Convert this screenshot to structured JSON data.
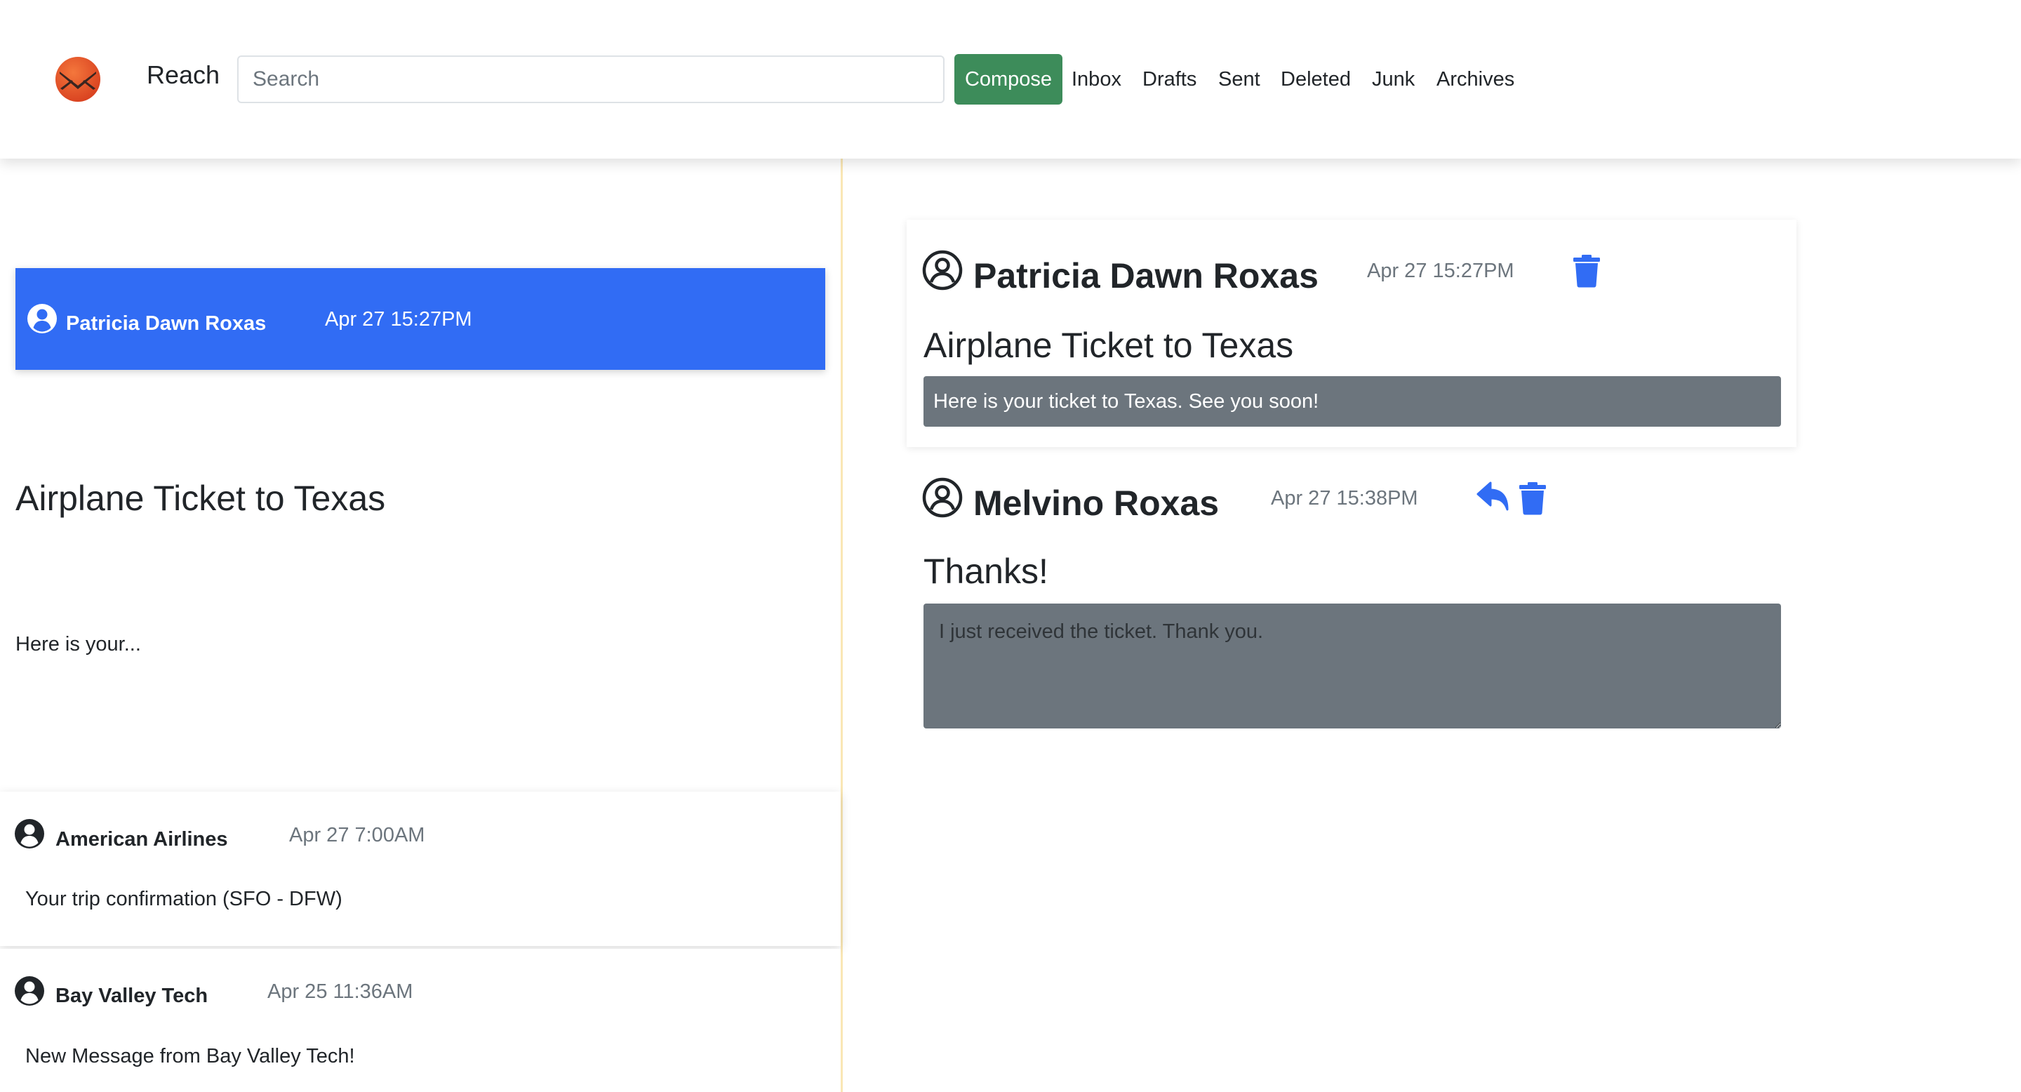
{
  "header": {
    "brand": "Reach",
    "search_placeholder": "Search",
    "compose_label": "Compose",
    "nav": [
      "Inbox",
      "Drafts",
      "Sent",
      "Deleted",
      "Junk",
      "Archives"
    ]
  },
  "colors": {
    "accent": "#316cf4",
    "compose": "#3d8c5a",
    "message_box": "#6c757d",
    "divider": "#fae7b5",
    "logo": "#e8502a"
  },
  "mail_list": {
    "selected": {
      "sender": "Patricia Dawn Roxas",
      "date": "Apr 27 15:27PM",
      "subject": "Airplane Ticket to Texas",
      "snippet": "Here is your..."
    },
    "items": [
      {
        "sender": "American Airlines",
        "date": "Apr 27 7:00AM",
        "preview": "Your trip confirmation (SFO - DFW)"
      },
      {
        "sender": "Bay Valley Tech",
        "date": "Apr 25 11:36AM",
        "preview": "New Message from Bay Valley Tech!"
      }
    ]
  },
  "thread": {
    "message": {
      "sender": "Patricia Dawn Roxas",
      "date": "Apr 27 15:27PM",
      "subject": "Airplane Ticket to Texas",
      "body": "Here is your ticket to Texas. See you soon!"
    },
    "reply": {
      "sender": "Melvino Roxas",
      "date": "Apr 27 15:38PM",
      "subject": "Thanks!",
      "placeholder": "I just received the ticket. Thank you."
    }
  },
  "icons": {
    "logo": "mail-logo-icon",
    "user": "user-circle-icon",
    "delete": "trash-icon",
    "reply": "reply-icon"
  }
}
